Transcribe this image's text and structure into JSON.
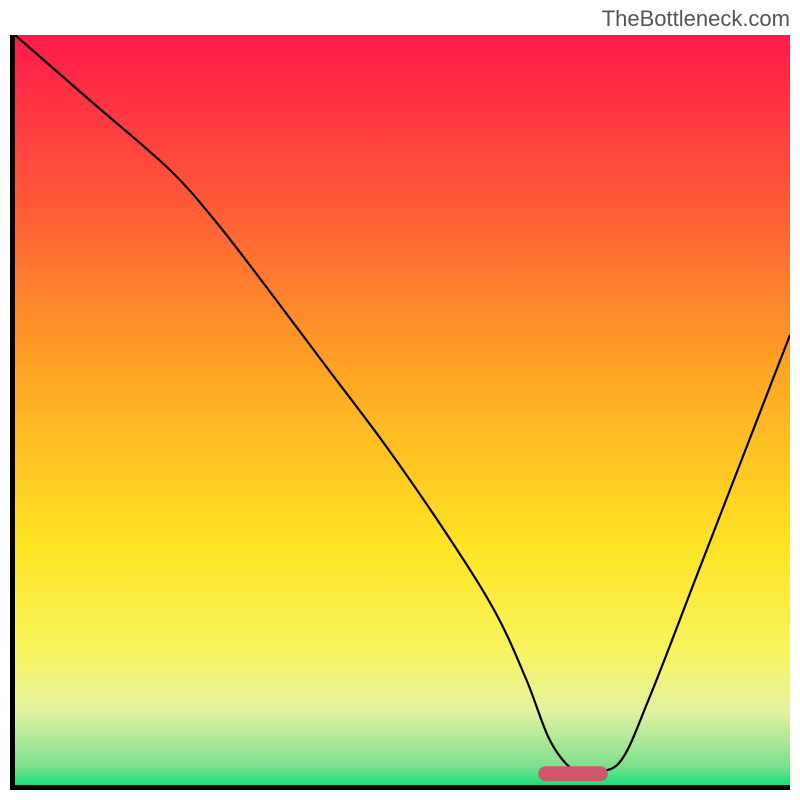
{
  "watermark": "TheBottleneck.com",
  "chart_data": {
    "type": "line",
    "title": "",
    "xlabel": "",
    "ylabel": "",
    "xlim": [
      0,
      100
    ],
    "ylim": [
      0,
      100
    ],
    "background_gradient": {
      "type": "vertical",
      "stops": [
        {
          "pos": 0.0,
          "color": "#ff1a4a"
        },
        {
          "pos": 0.22,
          "color": "#ff5838"
        },
        {
          "pos": 0.45,
          "color": "#ffa524"
        },
        {
          "pos": 0.68,
          "color": "#ffe423"
        },
        {
          "pos": 0.82,
          "color": "#f7f45e"
        },
        {
          "pos": 0.9,
          "color": "#e5f2a0"
        },
        {
          "pos": 0.975,
          "color": "#7de08f"
        },
        {
          "pos": 1.0,
          "color": "#19e07a"
        }
      ]
    },
    "series": [
      {
        "name": "bottleneck-curve",
        "x": [
          0,
          10,
          20,
          26,
          32,
          40,
          48,
          56,
          62,
          66,
          69,
          72,
          74,
          78,
          82,
          88,
          94,
          100
        ],
        "y": [
          100,
          91,
          82,
          75,
          67,
          56,
          45,
          33,
          23,
          14,
          6,
          2,
          2,
          3,
          12,
          28,
          44,
          60
        ]
      }
    ],
    "marker": {
      "name": "optimal-range-marker",
      "x_center": 72,
      "y": 1.5,
      "width": 9,
      "height": 2,
      "color": "#d0566a"
    }
  }
}
